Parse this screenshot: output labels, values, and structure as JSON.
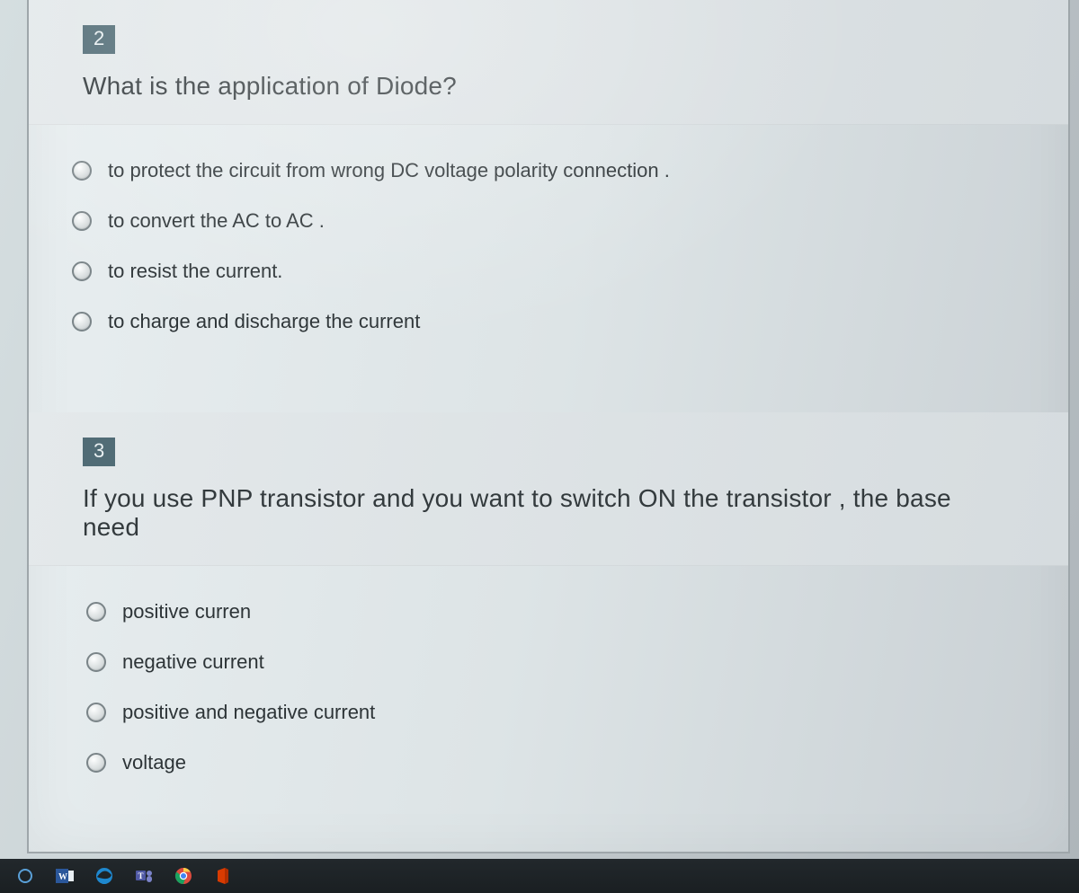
{
  "questions": [
    {
      "number": "2",
      "text": "What is the application of Diode?",
      "options": [
        "to protect the circuit from wrong DC voltage polarity connection .",
        "to convert the AC to AC .",
        "to resist the current.",
        "to charge and discharge the current"
      ]
    },
    {
      "number": "3",
      "text": "If you use PNP transistor and you want to switch ON the transistor , the base need",
      "options": [
        "positive curren",
        "negative current",
        "positive and negative current",
        "voltage"
      ]
    }
  ],
  "taskbar": {
    "items": [
      "word-icon",
      "edge-icon",
      "teams-icon",
      "chrome-icon",
      "office-icon"
    ]
  }
}
